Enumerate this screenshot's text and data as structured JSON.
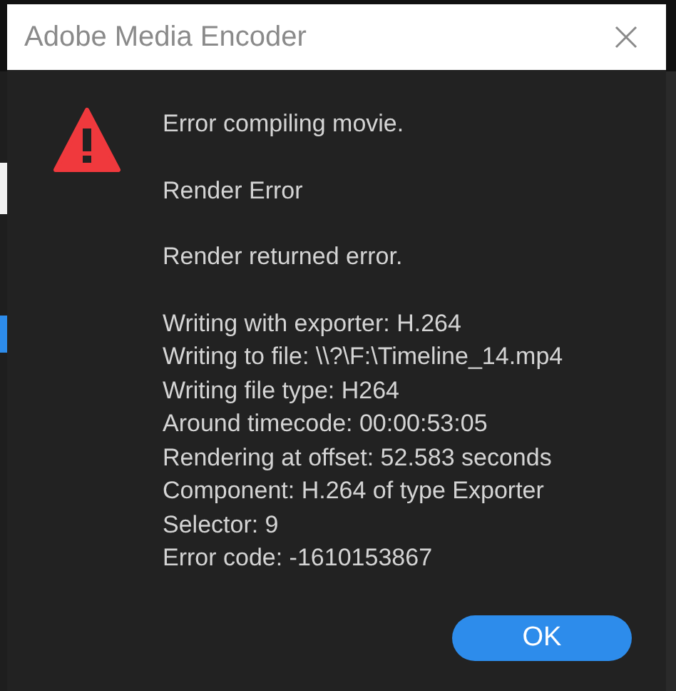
{
  "window": {
    "title": "Adobe Media Encoder"
  },
  "message": {
    "paragraphs": [
      [
        "Error compiling movie."
      ],
      [
        "Render Error"
      ],
      [
        "Render returned error."
      ],
      [
        "Writing with exporter: H.264",
        "Writing to file: \\\\?\\F:\\Timeline_14.mp4",
        "Writing file type: H264",
        "Around timecode: 00:00:53:05",
        "Rendering at offset: 52.583 seconds",
        "Component: H.264 of type Exporter",
        "Selector: 9",
        "Error code: -1610153867"
      ]
    ]
  },
  "buttons": [
    {
      "label": "OK"
    }
  ]
}
